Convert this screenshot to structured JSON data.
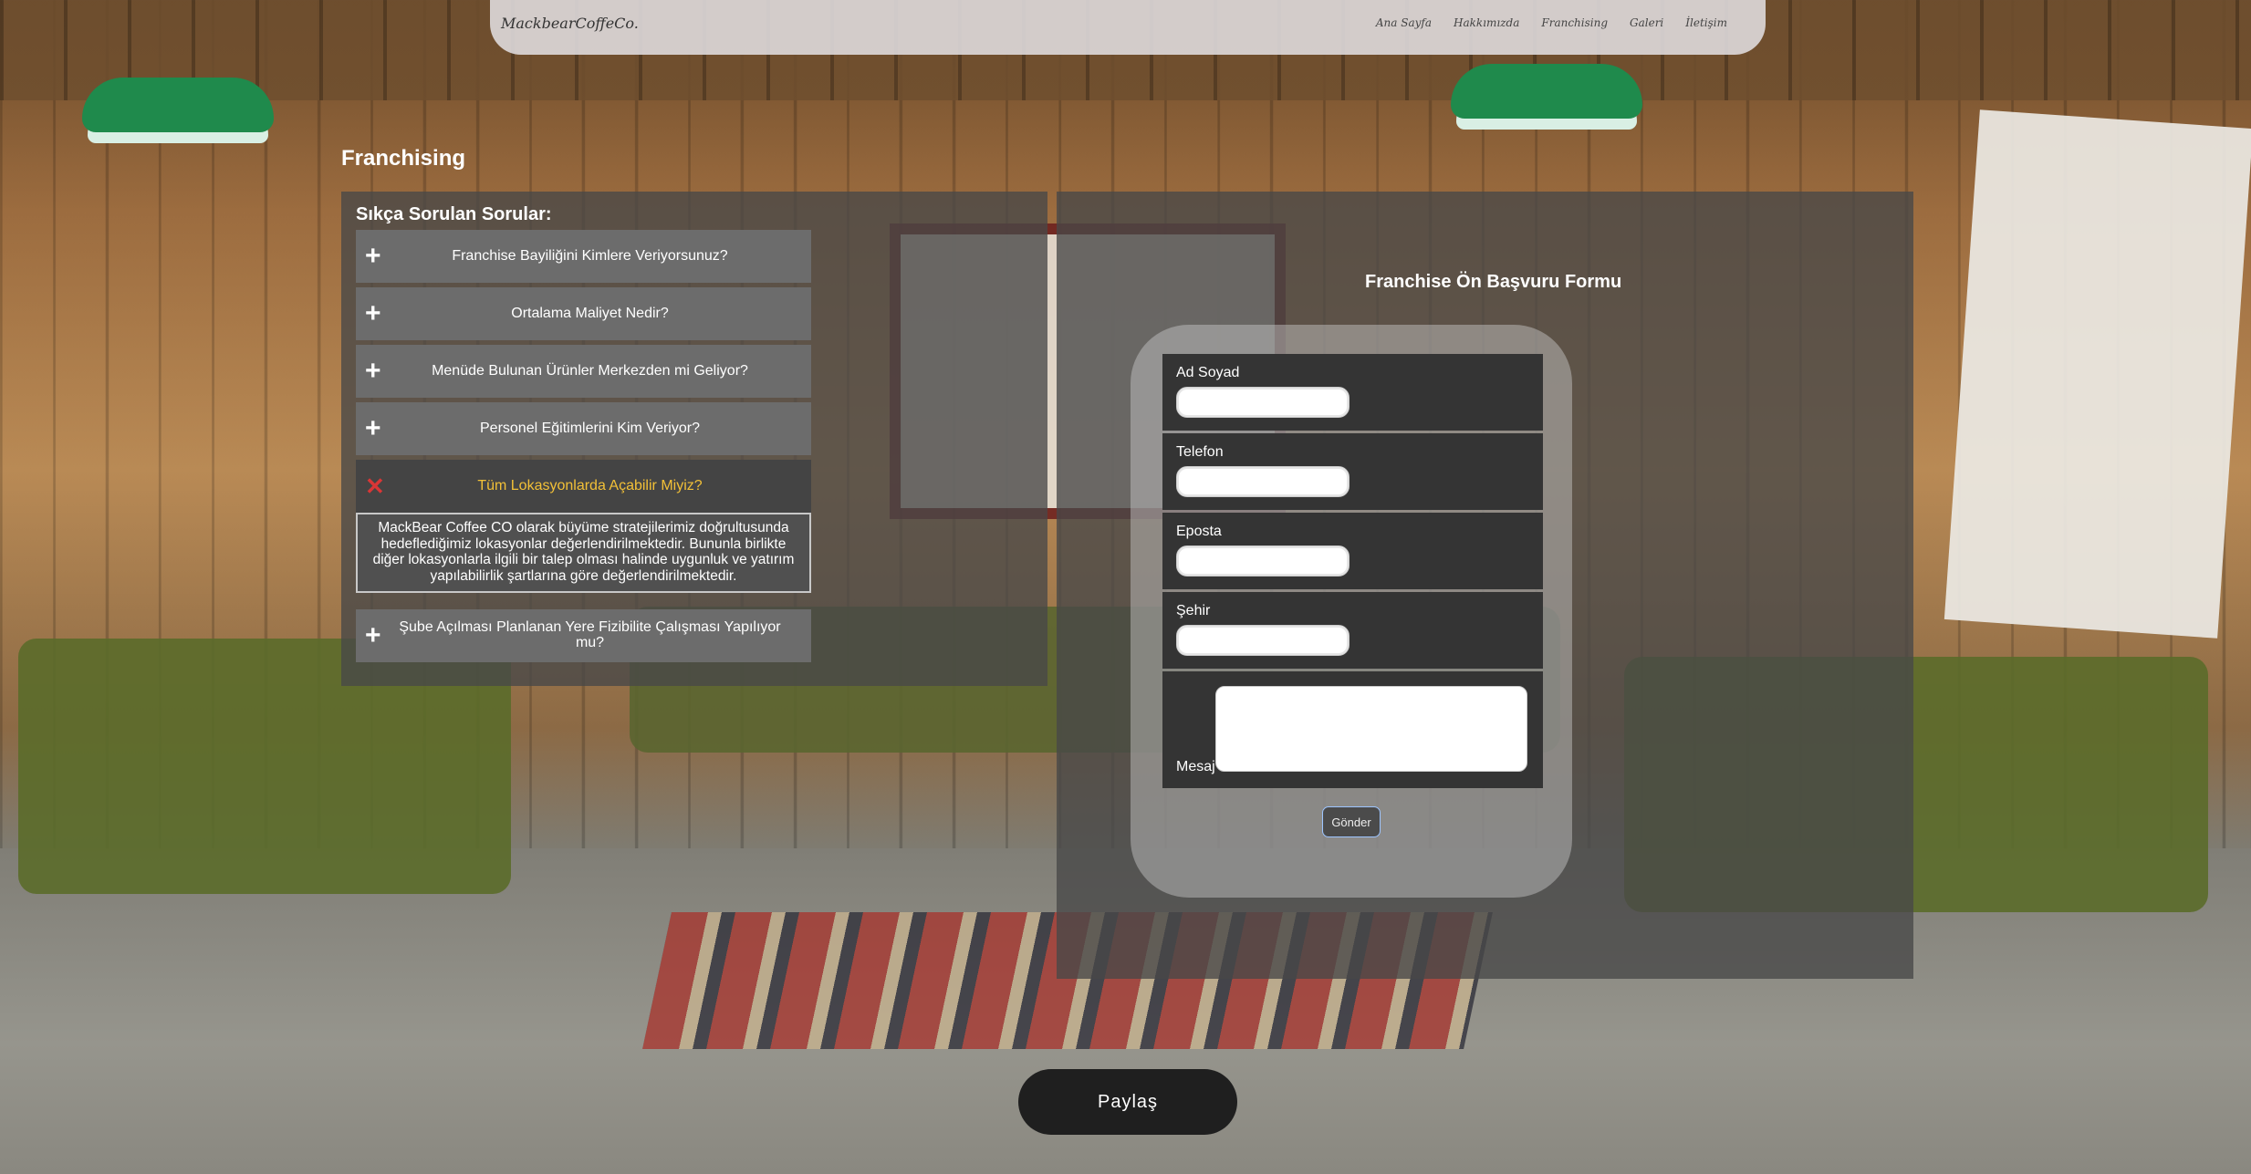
{
  "nav": {
    "brand": "MackbearCoffeCo.",
    "links": [
      "Ana Sayfa",
      "Hakkımızda",
      "Franchising",
      "Galeri",
      "İletişim"
    ]
  },
  "page": {
    "title": "Franchising"
  },
  "faq": {
    "heading": "Sıkça Sorulan Sorular:",
    "items": [
      {
        "symbol": "+",
        "question": "Franchise Bayiliğini Kimlere Veriyorsunuz?"
      },
      {
        "symbol": "+",
        "question": "Ortalama Maliyet Nedir?"
      },
      {
        "symbol": "+",
        "question": "Menüde Bulunan Ürünler Merkezden mi Geliyor?"
      },
      {
        "symbol": "+",
        "question": "Personel Eğitimlerini Kim Veriyor?"
      },
      {
        "symbol": "✕",
        "question": "Tüm Lokasyonlarda Açabilir Miyiz?",
        "answer": "MackBear Coffee CO olarak büyüme stratejilerimiz doğrultusunda hedeflediğimiz lokasyonlar değerlendirilmektedir. Bununla birlikte diğer lokasyonlarla ilgili bir talep olması halinde uygunluk ve yatırım yapılabilirlik şartlarına göre değerlendirilmektedir."
      },
      {
        "symbol": "+",
        "question": "Şube Açılması Planlanan Yere Fizibilite Çalışması Yapılıyor mu?"
      }
    ]
  },
  "form": {
    "title": "Franchise Ön Başvuru Formu",
    "fields": {
      "name": {
        "label": "Ad Soyad",
        "value": ""
      },
      "phone": {
        "label": "Telefon",
        "value": ""
      },
      "email": {
        "label": "Eposta",
        "value": ""
      },
      "city": {
        "label": "Şehir",
        "value": ""
      },
      "message": {
        "label": "Mesaj",
        "value": ""
      }
    },
    "submit_label": "Gönder"
  },
  "share_label": "Paylaş"
}
